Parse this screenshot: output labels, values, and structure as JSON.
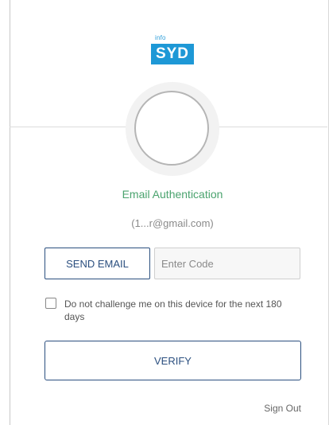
{
  "logo": {
    "small_text": "info",
    "main_text": "SYD",
    "color": "#1e98d6"
  },
  "auth": {
    "title": "Email Authentication",
    "email_masked": "(1...r@gmail.com)",
    "title_color": "#4aa36e"
  },
  "actions": {
    "send_email_label": "SEND EMAIL",
    "code_placeholder": "Enter Code",
    "code_value": "",
    "verify_label": "VERIFY",
    "sign_out_label": "Sign Out",
    "button_color": "#2b4f7f"
  },
  "remember": {
    "label": "Do not challenge me on this device for the next 180 days",
    "checked": false
  },
  "avatar": {
    "icon": "user-avatar-placeholder"
  }
}
